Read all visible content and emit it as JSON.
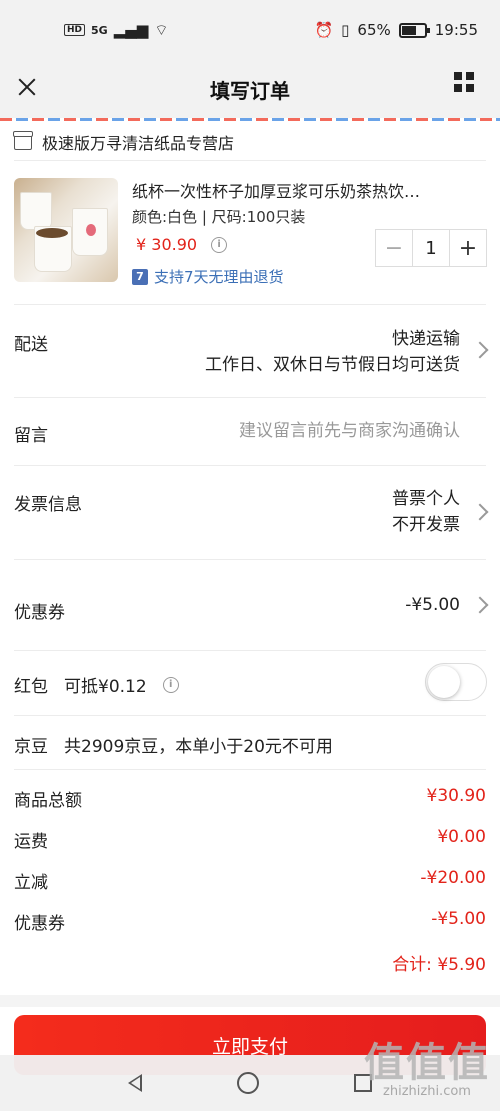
{
  "status_bar": {
    "hd": "HD",
    "network": "5G",
    "battery_pct": "65%",
    "time": "19:55"
  },
  "header": {
    "title": "填写订单"
  },
  "store": {
    "name": "极速版万寻清洁纸品专营店"
  },
  "product": {
    "title": "纸杯一次性杯子加厚豆浆可乐奶茶热饮…",
    "spec": "颜色:白色 | 尺码:100只装",
    "price": "¥ 30.90",
    "quantity": "1",
    "minus": "−",
    "plus": "+",
    "return_badge": "7",
    "return_text": "支持7天无理由退货"
  },
  "delivery": {
    "label": "配送",
    "method": "快递运输",
    "schedule": "工作日、双休日与节假日均可送货"
  },
  "message": {
    "label": "留言",
    "placeholder": "建议留言前先与商家沟通确认"
  },
  "invoice": {
    "label": "发票信息",
    "type": "普票个人",
    "status": "不开发票"
  },
  "coupon": {
    "label": "优惠券",
    "value": "-¥5.00"
  },
  "redpacket": {
    "label": "红包",
    "deduct": "可抵¥0.12",
    "enabled": false
  },
  "jingdou": {
    "label": "京豆",
    "text": "共2909京豆，本单小于20元不可用"
  },
  "summary": [
    {
      "label": "商品总额",
      "value": "¥30.90"
    },
    {
      "label": "运费",
      "value": "¥0.00"
    },
    {
      "label": "立减",
      "value": "-¥20.00"
    },
    {
      "label": "优惠券",
      "value": "-¥5.00"
    }
  ],
  "total": {
    "text": "合计: ¥5.90"
  },
  "pay_button": {
    "label": "立即支付"
  },
  "watermark": {
    "big": "值值值",
    "small": "zhizhizhi.com"
  },
  "colors": {
    "accent": "#e2231a",
    "link": "#3b6fb6"
  }
}
